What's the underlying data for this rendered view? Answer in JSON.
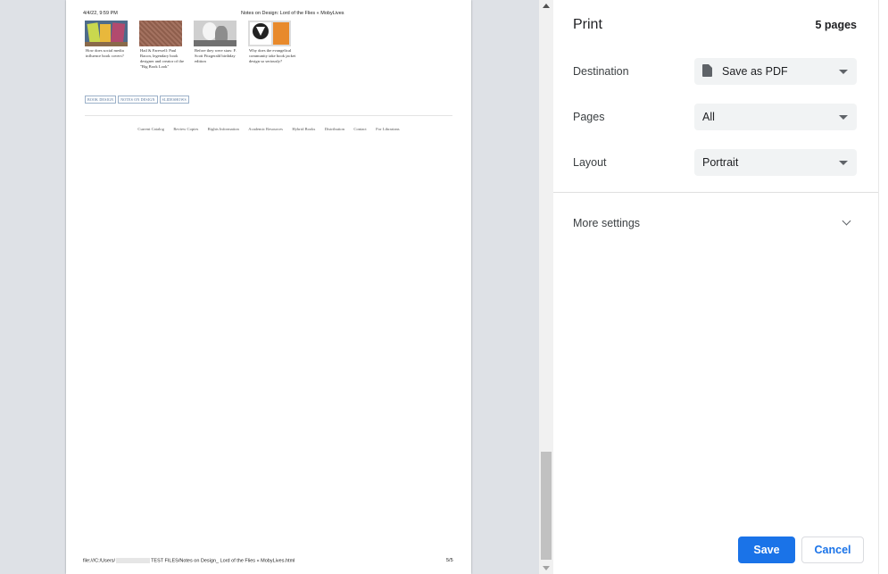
{
  "preview": {
    "header_datetime": "4/4/22, 9:59 PM",
    "header_title": "Notes on Design: Lord of the Flies « MobyLives",
    "related_posts": [
      {
        "caption": "How does social media influence book covers?"
      },
      {
        "caption": "Hail & Farewell: Paul Bacon, legendary book designer and creator of the \"Big Book Look\""
      },
      {
        "caption": "Before they were stars: F. Scott Fitzgerald birthday edition"
      },
      {
        "caption": "Why does the evangelical community take book jacket design so seriously?"
      }
    ],
    "tags": [
      "BOOK DESIGN",
      "NOTES ON DESIGN",
      "SLIDESHOWS"
    ],
    "footer_links": [
      "Current Catalog",
      "Review Copies",
      "Rights Information",
      "Academic Resources",
      "Hybrid Books",
      "Distribution",
      "Contact",
      "For Librarians"
    ],
    "footer_path_start": "file:///C:/Users/",
    "footer_path_end": "TEST FILES/Notes on Design_ Lord of the Flies « MobyLives.html",
    "page_number": "5/5"
  },
  "settings": {
    "title": "Print",
    "page_count": "5 pages",
    "destination": {
      "label": "Destination",
      "value": "Save as PDF",
      "icon": "document-icon"
    },
    "pages": {
      "label": "Pages",
      "value": "All"
    },
    "layout": {
      "label": "Layout",
      "value": "Portrait"
    },
    "more_settings": "More settings",
    "save_label": "Save",
    "cancel_label": "Cancel",
    "colors": {
      "accent": "#1a73e8",
      "select_bg": "#f1f3f4",
      "preview_bg": "#dee1e6"
    }
  }
}
